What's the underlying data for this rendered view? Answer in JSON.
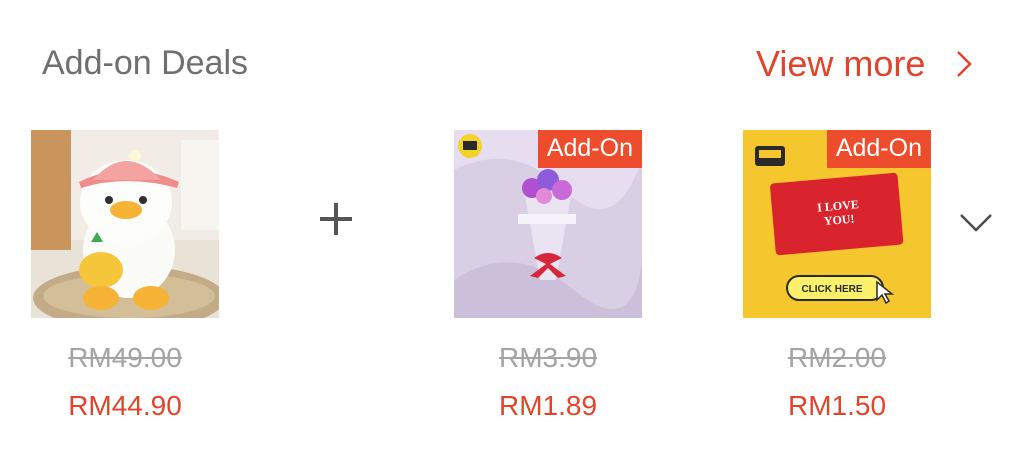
{
  "header": {
    "title": "Add-on Deals",
    "view_more_label": "View more"
  },
  "products": [
    {
      "name": "Duck plush toy",
      "original_price": "RM49.00",
      "price": "RM44.90"
    },
    {
      "badge": "Add-On",
      "original_price": "RM3.90",
      "price": "RM1.89"
    },
    {
      "badge": "Add-On",
      "original_price": "RM2.00",
      "price": "RM1.50",
      "card_text": [
        "I LOVE",
        "YOU!"
      ],
      "button_text": "CLICK HERE"
    }
  ],
  "icons": {
    "plus": "plus-icon",
    "view_more_arrow": "chevron-right-icon",
    "expand": "chevron-down-icon"
  },
  "colors": {
    "accent": "#ee4d2d",
    "price": "#e0452c",
    "old_price": "#a4a4a4",
    "title": "#6f6f6f"
  }
}
